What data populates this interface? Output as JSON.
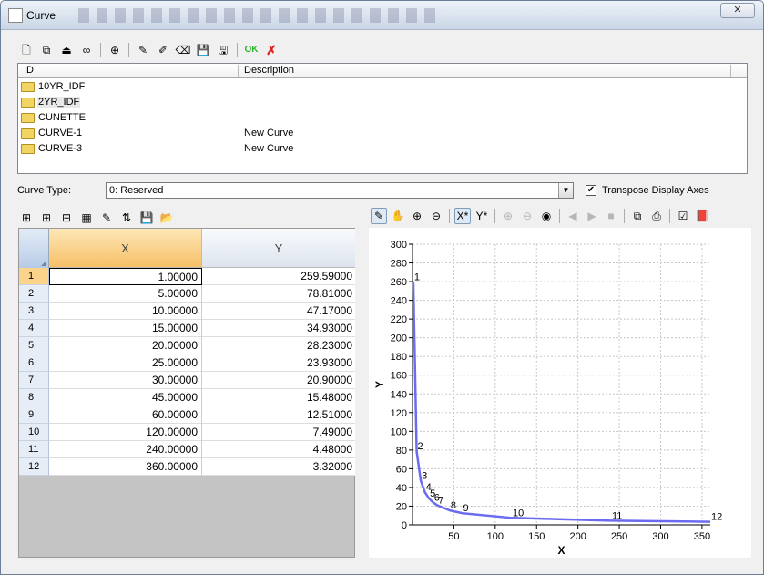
{
  "window": {
    "title": "Curve",
    "close_glyph": "✕"
  },
  "main_toolbar": {
    "buttons": [
      {
        "name": "new-icon",
        "glyph": "🗋"
      },
      {
        "name": "copy-icon",
        "glyph": "⧉"
      },
      {
        "name": "import-icon",
        "glyph": "⏏"
      },
      {
        "name": "link-icon",
        "glyph": "∞"
      },
      {
        "name": "add-icon",
        "glyph": "⊕"
      },
      {
        "name": "pencil-icon",
        "glyph": "✎"
      },
      {
        "name": "edit-icon",
        "glyph": "✐"
      },
      {
        "name": "eraser-icon",
        "glyph": "⌫"
      },
      {
        "name": "save-icon",
        "glyph": "💾"
      },
      {
        "name": "save-as-icon",
        "glyph": "🖫"
      }
    ],
    "ok_label": "OK",
    "cancel_glyph": "✗"
  },
  "curve_list": {
    "columns": [
      "ID",
      "Description"
    ],
    "rows": [
      {
        "id": "10YR_IDF",
        "description": ""
      },
      {
        "id": "2YR_IDF",
        "description": ""
      },
      {
        "id": "CUNETTE",
        "description": ""
      },
      {
        "id": "CURVE-1",
        "description": "New Curve"
      },
      {
        "id": "CURVE-3",
        "description": "New Curve"
      }
    ]
  },
  "curve_type": {
    "label": "Curve Type:",
    "value": "0: Reserved",
    "arrow": "▼"
  },
  "transpose": {
    "label": "Transpose Display Axes",
    "checked": true,
    "check_glyph": "✔"
  },
  "table_toolbar": [
    {
      "name": "insert-row-icon",
      "glyph": "⊞"
    },
    {
      "name": "append-row-icon",
      "glyph": "⊞"
    },
    {
      "name": "delete-row-icon",
      "glyph": "⊟"
    },
    {
      "name": "renumber-icon",
      "glyph": "▦"
    },
    {
      "name": "edit-grid-icon",
      "glyph": "✎"
    },
    {
      "name": "sort-icon",
      "glyph": "⇅"
    },
    {
      "name": "save-grid-icon",
      "glyph": "💾"
    },
    {
      "name": "open-folder-icon",
      "glyph": "📂"
    }
  ],
  "chart_toolbar": [
    {
      "name": "draw-icon",
      "glyph": "✎",
      "pressed": true
    },
    {
      "name": "pan-hand-icon",
      "glyph": "✋"
    },
    {
      "name": "zoom-in-icon",
      "glyph": "⊕"
    },
    {
      "name": "zoom-out-icon",
      "glyph": "⊖"
    },
    {
      "sep": true
    },
    {
      "name": "x-axis-icon",
      "glyph": "X*",
      "pressed": true
    },
    {
      "name": "y-axis-icon",
      "glyph": "Y*"
    },
    {
      "sep": true
    },
    {
      "name": "zoom-in-disabled-icon",
      "glyph": "⊕",
      "dim": true
    },
    {
      "name": "zoom-out-disabled-icon",
      "glyph": "⊖",
      "dim": true
    },
    {
      "name": "globe-icon",
      "glyph": "◉"
    },
    {
      "sep": true
    },
    {
      "name": "back-icon",
      "glyph": "◀",
      "dim": true
    },
    {
      "name": "play-icon",
      "glyph": "▶",
      "dim": true
    },
    {
      "name": "stop-icon",
      "glyph": "■",
      "dim": true
    },
    {
      "sep": true
    },
    {
      "name": "copy-chart-icon",
      "glyph": "⧉"
    },
    {
      "name": "print-icon",
      "glyph": "⎙"
    },
    {
      "sep": true
    },
    {
      "name": "properties-icon",
      "glyph": "☑"
    },
    {
      "name": "help-book-icon",
      "glyph": "📕"
    }
  ],
  "table": {
    "headers": [
      "X",
      "Y"
    ],
    "rows": [
      {
        "n": "1",
        "x": "1.00000",
        "y": "259.59000"
      },
      {
        "n": "2",
        "x": "5.00000",
        "y": "78.81000"
      },
      {
        "n": "3",
        "x": "10.00000",
        "y": "47.17000"
      },
      {
        "n": "4",
        "x": "15.00000",
        "y": "34.93000"
      },
      {
        "n": "5",
        "x": "20.00000",
        "y": "28.23000"
      },
      {
        "n": "6",
        "x": "25.00000",
        "y": "23.93000"
      },
      {
        "n": "7",
        "x": "30.00000",
        "y": "20.90000"
      },
      {
        "n": "8",
        "x": "45.00000",
        "y": "15.48000"
      },
      {
        "n": "9",
        "x": "60.00000",
        "y": "12.51000"
      },
      {
        "n": "10",
        "x": "120.00000",
        "y": "7.49000"
      },
      {
        "n": "11",
        "x": "240.00000",
        "y": "4.48000"
      },
      {
        "n": "12",
        "x": "360.00000",
        "y": "3.32000"
      }
    ]
  },
  "chart_data": {
    "type": "line",
    "xlabel": "X",
    "ylabel": "Y",
    "x": [
      1,
      5,
      10,
      15,
      20,
      25,
      30,
      45,
      60,
      120,
      240,
      360
    ],
    "y": [
      259.59,
      78.81,
      47.17,
      34.93,
      28.23,
      23.93,
      20.9,
      15.48,
      12.51,
      7.49,
      4.48,
      3.32
    ],
    "point_labels": [
      "1",
      "2",
      "3",
      "4",
      "5",
      "6",
      "7",
      "8",
      "9",
      "10",
      "11",
      "12"
    ],
    "xlim": [
      0,
      360
    ],
    "ylim": [
      0,
      300
    ],
    "xticks": [
      50,
      100,
      150,
      200,
      250,
      300,
      350
    ],
    "yticks": [
      0,
      20,
      40,
      60,
      80,
      100,
      120,
      140,
      160,
      180,
      200,
      220,
      240,
      260,
      280,
      300
    ],
    "grid": true,
    "line_color": "#6b6bf0"
  }
}
